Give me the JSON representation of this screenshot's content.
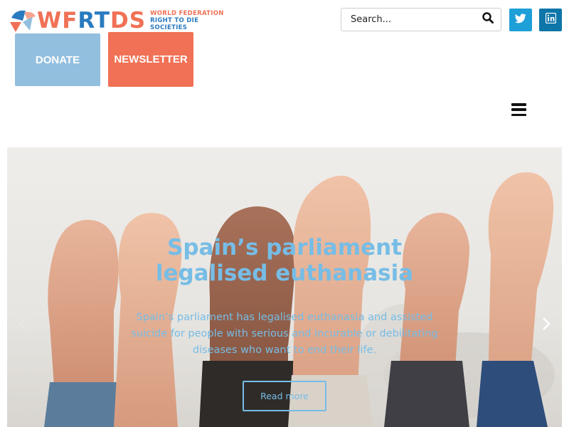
{
  "header": {
    "logo": {
      "wordmark_part1": "WF",
      "wordmark_part2": "RT",
      "wordmark_part3": "DS",
      "subline1": "WORLD FEDERATION",
      "subline2": "RIGHT TO DIE SOCIETIES"
    },
    "donate_label": "DONATE",
    "newsletter_label": "NEWSLETTER",
    "search": {
      "placeholder": "Search...",
      "value": ""
    },
    "icons": {
      "search": "search-icon",
      "twitter": "twitter-icon",
      "linkedin": "linkedin-icon",
      "menu": "hamburger-menu-icon"
    }
  },
  "hero": {
    "title": "Spain’s parliament legalised euthanasia",
    "text": "Spain’s parliament has legalised euthanasia and assisted suicide for people with serious and incurable or debilitating diseases who want to end their life.",
    "button_label": "Read more",
    "icons": {
      "prev": "chevron-left-icon",
      "next": "chevron-right-icon"
    }
  },
  "colors": {
    "brand_coral": "#f07156",
    "brand_blue": "#2a7bbf",
    "donate_blue": "#93bfdf",
    "hero_text": "#76bde6",
    "twitter": "#1d9fd8",
    "linkedin": "#0e76a8"
  }
}
